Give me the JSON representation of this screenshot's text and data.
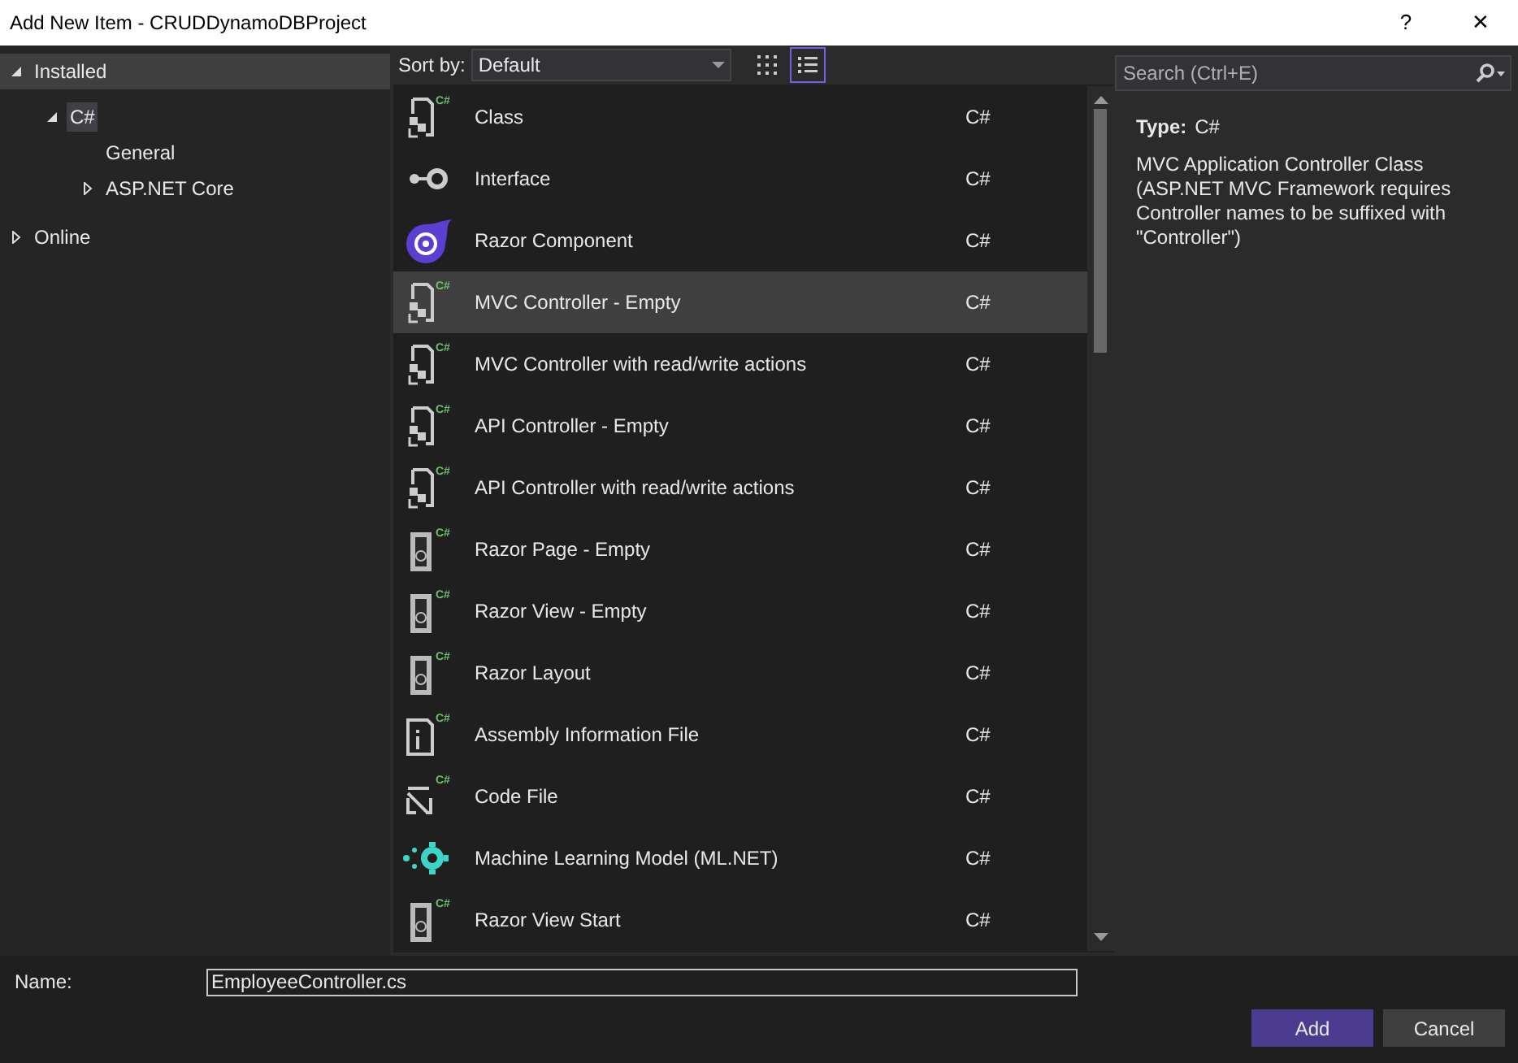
{
  "window": {
    "title": "Add New Item - CRUDDynamoDBProject",
    "help_button": "?",
    "close_button": "✕"
  },
  "tree": [
    {
      "label": "Installed",
      "expanded": true,
      "selected": false,
      "header": true,
      "children": [
        {
          "label": "C#",
          "expanded": true,
          "selected": true,
          "children": [
            {
              "label": "General",
              "selected": false
            },
            {
              "label": "ASP.NET Core",
              "expanded": false,
              "selected": false
            }
          ]
        }
      ]
    },
    {
      "label": "Online",
      "expanded": false,
      "selected": false,
      "header": false
    }
  ],
  "sort": {
    "label": "Sort by:",
    "value": "Default"
  },
  "view_mode": {
    "grid_selected": false,
    "list_selected": true
  },
  "search": {
    "placeholder": "Search (Ctrl+E)"
  },
  "templates": [
    {
      "name": "Class",
      "language": "C#",
      "kind": "class",
      "icon_badge": "C#",
      "selected": false
    },
    {
      "name": "Interface",
      "language": "C#",
      "kind": "interface",
      "selected": false
    },
    {
      "name": "Razor Component",
      "language": "C#",
      "kind": "razor-component",
      "selected": false
    },
    {
      "name": "MVC Controller - Empty",
      "language": "C#",
      "kind": "class",
      "icon_badge": "C#",
      "selected": true
    },
    {
      "name": "MVC Controller with read/write actions",
      "language": "C#",
      "kind": "class",
      "icon_badge": "C#",
      "selected": false
    },
    {
      "name": "API Controller - Empty",
      "language": "C#",
      "kind": "class",
      "icon_badge": "C#",
      "selected": false
    },
    {
      "name": "API Controller with read/write actions",
      "language": "C#",
      "kind": "class",
      "icon_badge": "C#",
      "selected": false
    },
    {
      "name": "Razor Page - Empty",
      "language": "C#",
      "kind": "razor",
      "icon_badge": "C#",
      "selected": false
    },
    {
      "name": "Razor View - Empty",
      "language": "C#",
      "kind": "razor",
      "icon_badge": "C#",
      "selected": false
    },
    {
      "name": "Razor Layout",
      "language": "C#",
      "kind": "razor",
      "icon_badge": "C#",
      "selected": false
    },
    {
      "name": "Assembly Information File",
      "language": "C#",
      "kind": "info",
      "icon_badge": "C#",
      "selected": false
    },
    {
      "name": "Code File",
      "language": "C#",
      "kind": "code",
      "icon_badge": "C#",
      "selected": false
    },
    {
      "name": "Machine Learning Model (ML.NET)",
      "language": "C#",
      "kind": "ml",
      "selected": false
    },
    {
      "name": "Razor View Start",
      "language": "C#",
      "kind": "razor",
      "icon_badge": "C#",
      "selected": false
    }
  ],
  "details": {
    "type_label": "Type:",
    "type_value": "C#",
    "description": "MVC Application Controller Class (ASP.NET MVC Framework requires Controller names to be suffixed with \"Controller\")"
  },
  "name_field": {
    "label": "Name:",
    "value": "EmployeeController.cs"
  },
  "buttons": [
    {
      "label": "Add",
      "kind": "primary"
    },
    {
      "label": "Cancel",
      "kind": "secondary"
    }
  ]
}
